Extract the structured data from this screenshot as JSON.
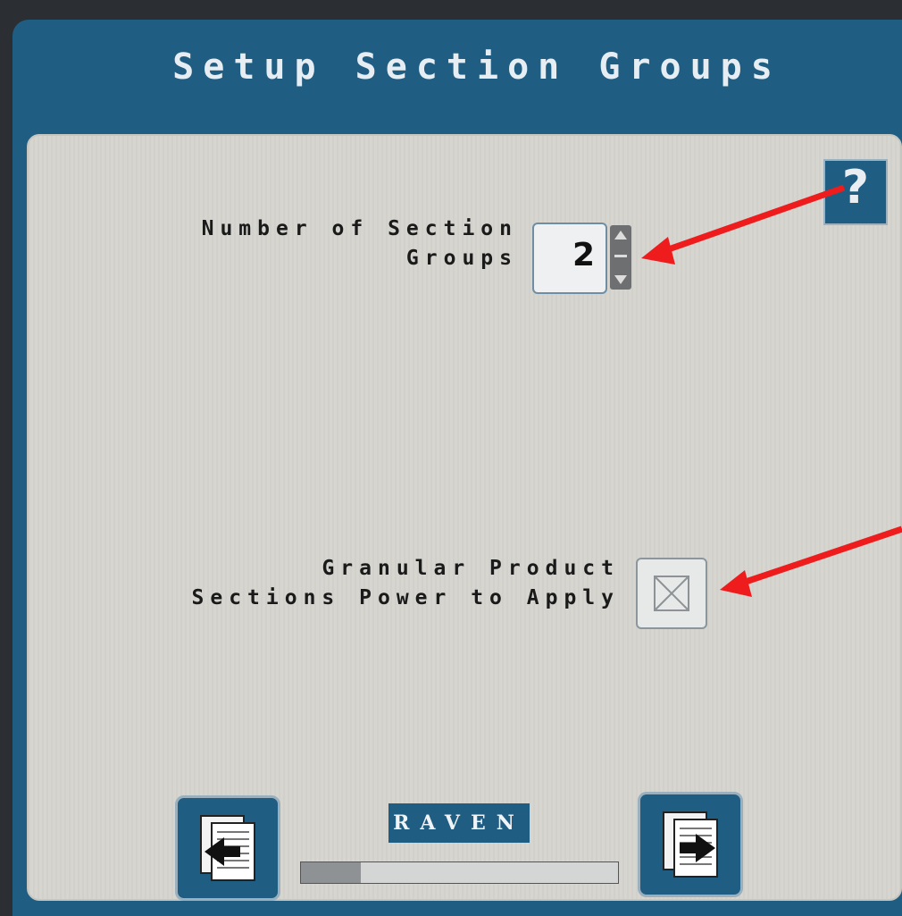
{
  "window": {
    "title": "Setup Section Groups"
  },
  "help": {
    "label": "?"
  },
  "fields": {
    "section_groups": {
      "label": "Number of Section\nGroups",
      "value": "2"
    },
    "granular": {
      "label": "Granular Product\nSections Power to Apply",
      "checked": true
    }
  },
  "footer": {
    "brand": "RAVEN",
    "progress": 0.19
  },
  "icons": {
    "back": "back-page-icon",
    "next": "next-page-icon",
    "help": "help-icon",
    "annotation": "red-arrow-icon"
  },
  "colors": {
    "frame": "#1f5d82",
    "panel": "#d6d5d0",
    "annotation": "#ee1c1c"
  }
}
